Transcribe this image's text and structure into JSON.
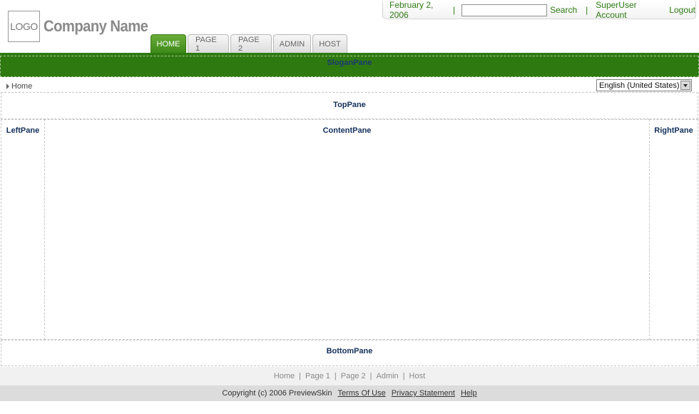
{
  "header": {
    "logo_text": "LOGO",
    "company_name": "Company Name",
    "date": "February 2, 2006",
    "date_separator": "|",
    "search_input_value": "",
    "search_label": "Search",
    "account_separator": "|",
    "account_label": "SuperUser Account",
    "logout_label": "Logout"
  },
  "tabs": [
    {
      "label": "HOME",
      "active": true
    },
    {
      "label": "PAGE 1",
      "active": false
    },
    {
      "label": "PAGE 2",
      "active": false
    },
    {
      "label": "ADMIN",
      "active": false
    },
    {
      "label": "HOST",
      "active": false
    }
  ],
  "slogan_pane": "SloganPane",
  "breadcrumb": {
    "label": "Home"
  },
  "language": {
    "selected": "English (United States)"
  },
  "panes": {
    "top": "TopPane",
    "left": "LeftPane",
    "content": "ContentPane",
    "right": "RightPane",
    "bottom": "BottomPane"
  },
  "footer": {
    "links": [
      "Home",
      "Page 1",
      "Page 2",
      "Admin",
      "Host"
    ],
    "separator": "|",
    "copyright": "Copyright (c) 2006 PreviewSkin",
    "terms": "Terms Of Use",
    "privacy": "Privacy Statement",
    "help": "Help"
  },
  "colors": {
    "accent_green": "#2f7a10",
    "link_green": "#2e7a12",
    "pane_label_navy": "#14305a"
  }
}
